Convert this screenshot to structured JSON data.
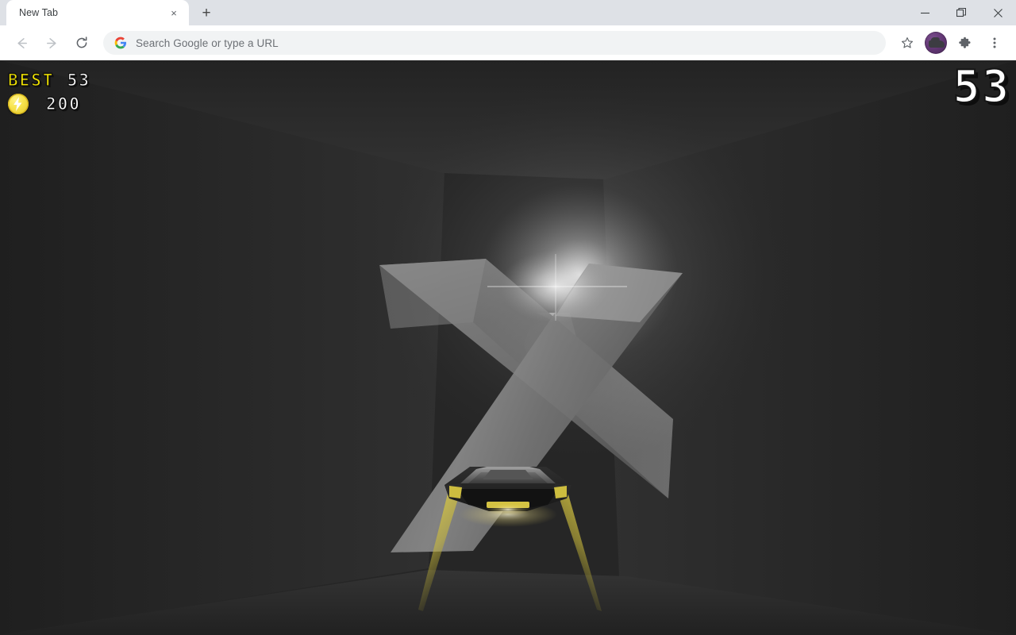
{
  "browser": {
    "tab": {
      "title": "New Tab",
      "close_label": "×"
    },
    "new_tab_button": "+",
    "window_controls": {
      "minimize": "minimize-icon",
      "maximize": "maximize-icon",
      "close": "close-icon"
    },
    "nav": {
      "back": "back-arrow-icon",
      "forward": "forward-arrow-icon",
      "reload": "reload-icon"
    },
    "omnibox": {
      "placeholder": "Search Google or type a URL",
      "value": "",
      "logo": "google-g-icon"
    },
    "actions": {
      "bookmark": "star-icon",
      "profile": "avatar-icon",
      "extensions": "puzzle-piece-icon",
      "menu": "three-dot-menu-icon"
    }
  },
  "game": {
    "hud": {
      "best_label": "BEST",
      "best_value": "53",
      "coin_icon": "lightning-coin-icon",
      "coin_value": "200",
      "score": "53"
    },
    "colors": {
      "background": "#262626",
      "accent_yellow": "#f3e500",
      "coin_yellow": "#f7e34d",
      "ship_dark": "#2b2b2b",
      "ship_light": "#8e8e8e",
      "obstacle_grey": "#6e6e6e"
    },
    "scene": {
      "ship": "player-ship",
      "obstacle": "x-shaped-barrier",
      "thrusters": 2
    }
  }
}
